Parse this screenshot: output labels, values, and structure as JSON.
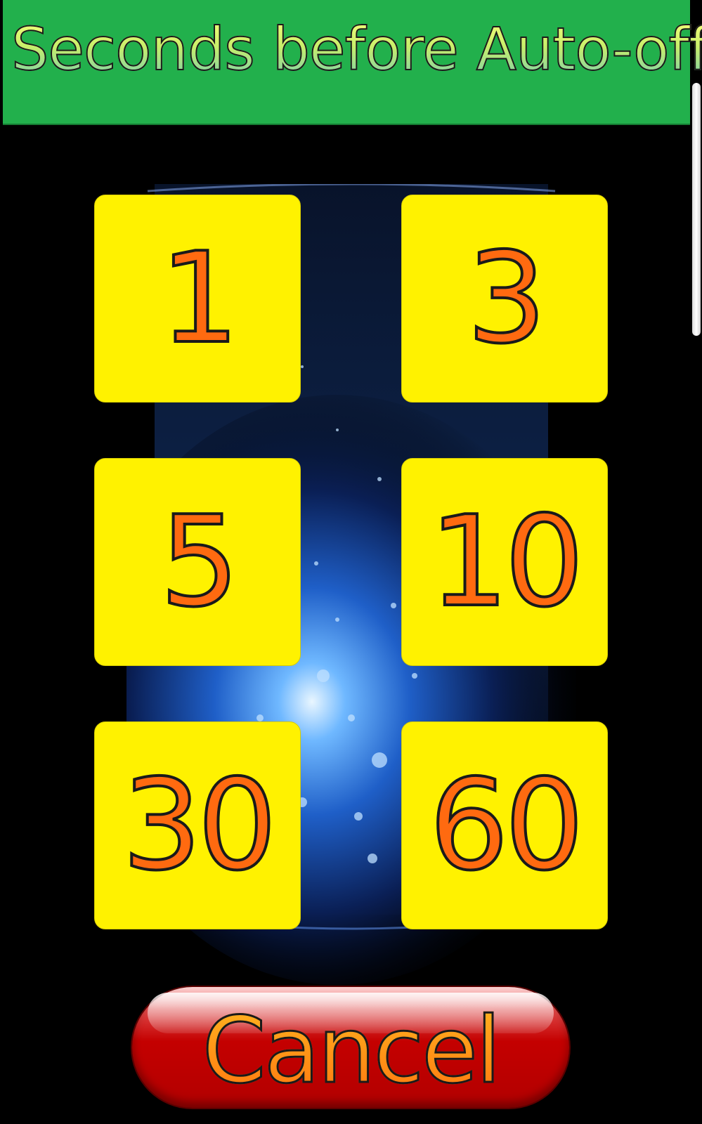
{
  "header": {
    "title": "Seconds before Auto-off"
  },
  "options": [
    {
      "label": "1"
    },
    {
      "label": "3"
    },
    {
      "label": "5"
    },
    {
      "label": "10"
    },
    {
      "label": "30"
    },
    {
      "label": "60"
    }
  ],
  "cancel": {
    "label": "Cancel"
  },
  "colors": {
    "header_bg": "#22b04c",
    "tile_bg": "#fff200",
    "tile_text": "#ff6a10",
    "cancel_bg": "#c40000",
    "cancel_text": "#ff8c1a",
    "background": "#000000"
  }
}
